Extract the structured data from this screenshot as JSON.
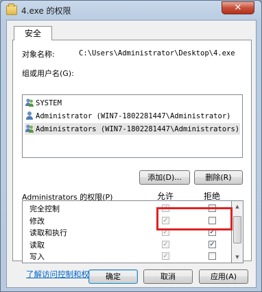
{
  "window": {
    "title": "4.exe 的权限",
    "close_glyph": "✕"
  },
  "tab": {
    "label": "安全"
  },
  "object": {
    "label": "对象名称:",
    "value": "C:\\Users\\Administrator\\Desktop\\4.exe"
  },
  "users": {
    "label": "组或用户名(G):",
    "items": [
      {
        "name": "SYSTEM",
        "icon": "user-group-icon",
        "selected": false
      },
      {
        "name": "Administrator (WIN7-1802281447\\Administrator)",
        "icon": "user-icon",
        "selected": false
      },
      {
        "name": "Administrators (WIN7-1802281447\\Administrators)",
        "icon": "user-group-icon",
        "selected": true
      }
    ]
  },
  "buttons": {
    "add": "添加(D)...",
    "remove": "删除(R)",
    "ok": "确定",
    "cancel": "取消",
    "apply": "应用(A)"
  },
  "permissions": {
    "label": "Administrators 的权限(P)",
    "allow_header": "允许",
    "deny_header": "拒绝",
    "rows": [
      {
        "name": "完全控制",
        "allow": true,
        "allow_enabled": false,
        "deny": false,
        "deny_enabled": true
      },
      {
        "name": "修改",
        "allow": true,
        "allow_enabled": false,
        "deny": false,
        "deny_enabled": true
      },
      {
        "name": "读取和执行",
        "allow": true,
        "allow_enabled": false,
        "deny": true,
        "deny_enabled": true
      },
      {
        "name": "读取",
        "allow": true,
        "allow_enabled": false,
        "deny": true,
        "deny_enabled": true
      },
      {
        "name": "写入",
        "allow": true,
        "allow_enabled": false,
        "deny": false,
        "deny_enabled": true
      }
    ]
  },
  "link": {
    "text": "了解访问控制和权限"
  },
  "colors": {
    "highlight": "#e02020",
    "link": "#0066cc",
    "selected_row": "#e5e5e5"
  }
}
